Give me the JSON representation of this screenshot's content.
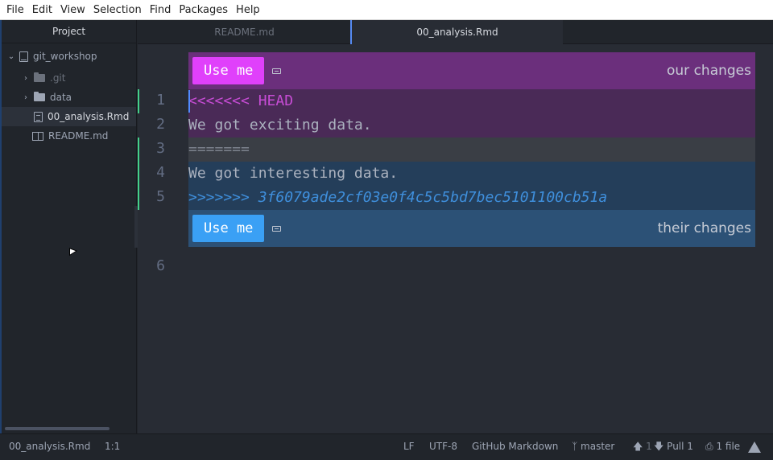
{
  "menu": [
    "File",
    "Edit",
    "View",
    "Selection",
    "Find",
    "Packages",
    "Help"
  ],
  "tree": {
    "title": "Project",
    "root": "git_workshop",
    "items": [
      ".git",
      "data",
      "00_analysis.Rmd",
      "README.md"
    ]
  },
  "tabs": [
    "README.md",
    "00_analysis.Rmd"
  ],
  "editor": {
    "line_numbers": [
      "1",
      "2",
      "3",
      "4",
      "5",
      "6"
    ],
    "ours_button": "Use me",
    "ours_label": "our changes",
    "theirs_button": "Use me",
    "theirs_label": "their changes",
    "lines": [
      "<<<<<<< HEAD",
      "We got exciting data.",
      "=======",
      "We got interesting data.",
      ">>>>>>> 3f6079ade2cf03e0f4c5c5bd7bec5101100cb51a"
    ]
  },
  "status": {
    "file": "00_analysis.Rmd",
    "cursor": "1:1",
    "line_ending": "LF",
    "encoding": "UTF-8",
    "grammar": "GitHub Markdown",
    "branch": "master",
    "push_count": "1",
    "pull": "Pull 1",
    "changed": "1 file"
  },
  "colors": {
    "ours_accent": "#e040fb",
    "theirs_accent": "#3aa0f5"
  }
}
